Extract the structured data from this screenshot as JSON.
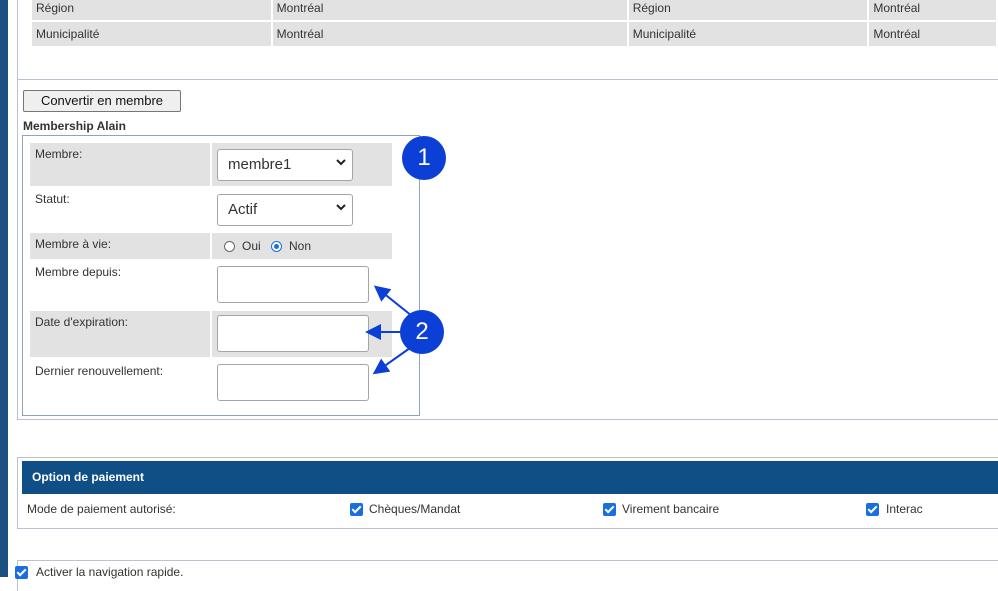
{
  "top_table": {
    "rows": [
      [
        "Région",
        "Montréal",
        "Région",
        "Montréal"
      ],
      [
        "Municipalité",
        "Montréal",
        "Municipalité",
        "Montréal"
      ]
    ]
  },
  "convert_button": "Convertir en membre",
  "membership": {
    "title": "Membership Alain",
    "membre_label": "Membre:",
    "membre_value": "membre1",
    "statut_label": "Statut:",
    "statut_value": "Actif",
    "vie_label": "Membre à vie:",
    "vie_options": [
      "Oui",
      "Non"
    ],
    "vie_selected": "Non",
    "depuis_label": "Membre depuis:",
    "depuis_value": "",
    "expiration_label": "Date d'expiration:",
    "expiration_value": "",
    "renouvellement_label": "Dernier renouvellement:",
    "renouvellement_value": ""
  },
  "annotations": {
    "badge1": "1",
    "badge2": "2",
    "badge_color": "#0b3fd6"
  },
  "payment": {
    "header": "Option de paiement",
    "mode_label": "Mode de paiement autorisé:",
    "methods": [
      {
        "label": "Chèques/Mandat",
        "checked": true
      },
      {
        "label": "Virement bancaire",
        "checked": true
      },
      {
        "label": "Interac",
        "checked": true
      }
    ],
    "header_color": "#0f4f86"
  },
  "quick_nav": {
    "label": "Activer la navigation rapide.",
    "checked": true
  },
  "colors": {
    "accent": "#1a6fe0",
    "row_gray": "#e2e2e2",
    "left_bar": "#1c4f82"
  }
}
